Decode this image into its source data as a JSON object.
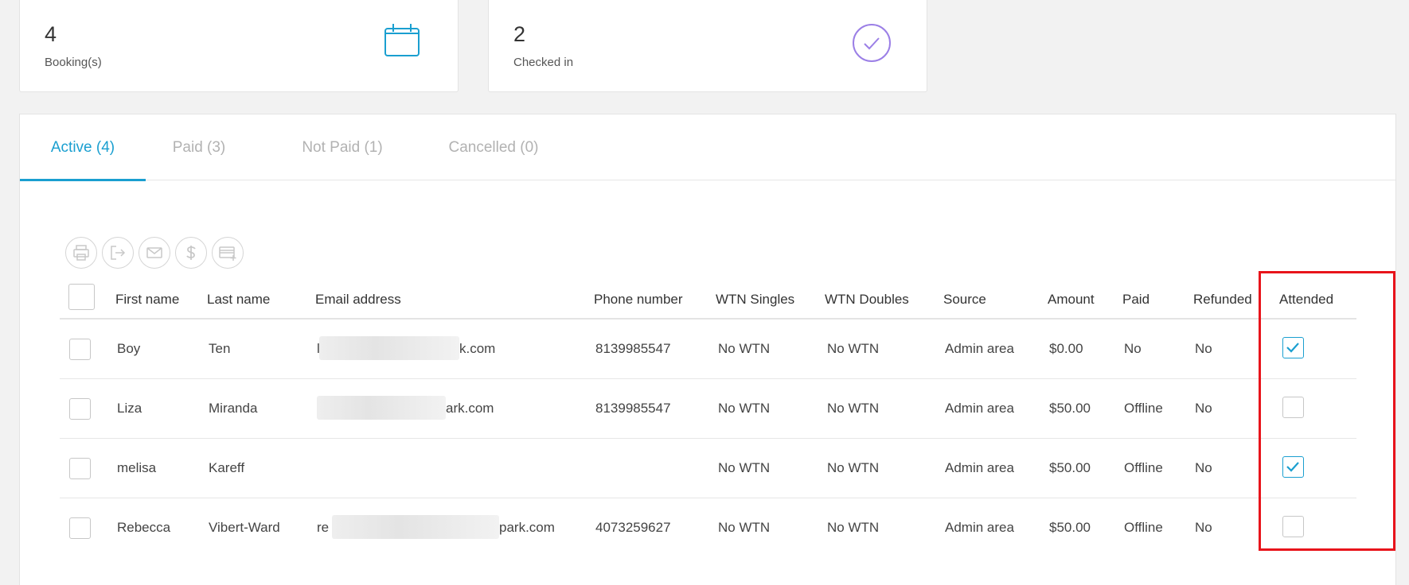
{
  "stats": [
    {
      "value": "4",
      "label": "Booking(s)",
      "icon": "calendar-icon"
    },
    {
      "value": "2",
      "label": "Checked in",
      "icon": "check-circle-icon"
    }
  ],
  "tabs": [
    {
      "label": "Active (4)",
      "active": true
    },
    {
      "label": "Paid (3)",
      "active": false
    },
    {
      "label": "Not Paid (1)",
      "active": false
    },
    {
      "label": "Cancelled (0)",
      "active": false
    }
  ],
  "toolbar": [
    "print-icon",
    "export-icon",
    "email-icon",
    "dollar-icon",
    "add-card-icon"
  ],
  "columns": {
    "first_name": "First name",
    "last_name": "Last name",
    "email": "Email address",
    "phone": "Phone number",
    "wtn_singles": "WTN Singles",
    "wtn_doubles": "WTN Doubles",
    "source": "Source",
    "amount": "Amount",
    "paid": "Paid",
    "refunded": "Refunded",
    "attended": "Attended"
  },
  "rows": [
    {
      "first": "Boy",
      "last": "Ten",
      "email_prefix": "l",
      "email_suffix": "k.com",
      "phone": "8139985547",
      "wtn_singles": "No WTN",
      "wtn_doubles": "No WTN",
      "source": "Admin area",
      "amount": "$0.00",
      "paid": "No",
      "refunded": "No",
      "attended": true
    },
    {
      "first": "Liza",
      "last": "Miranda",
      "email_prefix": "",
      "email_suffix": "ark.com",
      "phone": "8139985547",
      "wtn_singles": "No WTN",
      "wtn_doubles": "No WTN",
      "source": "Admin area",
      "amount": "$50.00",
      "paid": "Offline",
      "refunded": "No",
      "attended": false
    },
    {
      "first": "melisa",
      "last": "Kareff",
      "email_prefix": "",
      "email_suffix": "",
      "phone": "",
      "wtn_singles": "No WTN",
      "wtn_doubles": "No WTN",
      "source": "Admin area",
      "amount": "$50.00",
      "paid": "Offline",
      "refunded": "No",
      "attended": true
    },
    {
      "first": "Rebecca",
      "last": "Vibert-Ward",
      "email_prefix": "re",
      "email_suffix": "park.com",
      "phone": "4073259627",
      "wtn_singles": "No WTN",
      "wtn_doubles": "No WTN",
      "source": "Admin area",
      "amount": "$50.00",
      "paid": "Offline",
      "refunded": "No",
      "attended": false
    }
  ],
  "colors": {
    "accent": "#1a9fd0",
    "check_circle": "#9b7fe6",
    "highlight": "#e8141b"
  }
}
